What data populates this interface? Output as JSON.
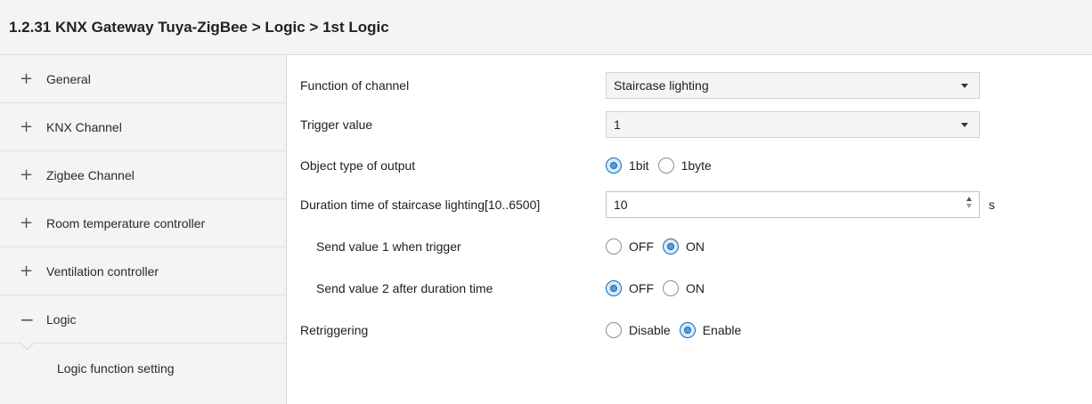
{
  "header": {
    "title": "1.2.31 KNX Gateway Tuya-ZigBee > Logic > 1st Logic"
  },
  "sidebar": {
    "items": [
      {
        "icon": "plus-icon",
        "symbol": "+",
        "label": "General"
      },
      {
        "icon": "plus-icon",
        "symbol": "+",
        "label": "KNX Channel"
      },
      {
        "icon": "plus-icon",
        "symbol": "+",
        "label": "Zigbee Channel"
      },
      {
        "icon": "plus-icon",
        "symbol": "+",
        "label": "Room temperature controller"
      },
      {
        "icon": "plus-icon",
        "symbol": "+",
        "label": "Ventilation controller"
      },
      {
        "icon": "minus-icon",
        "symbol": "−",
        "label": "Logic"
      }
    ],
    "sub_item": {
      "label": "Logic function setting"
    }
  },
  "params": {
    "function_of_channel": {
      "label": "Function of channel",
      "value": "Staircase lighting"
    },
    "trigger_value": {
      "label": "Trigger value",
      "value": "1"
    },
    "object_type": {
      "label": "Object type of output",
      "options": [
        "1bit",
        "1byte"
      ],
      "selected": "1bit"
    },
    "duration": {
      "label": "Duration time of staircase lighting[10..6500]",
      "value": "10",
      "unit": "s"
    },
    "send_value_1": {
      "label": "Send value 1 when trigger",
      "options": [
        "OFF",
        "ON"
      ],
      "selected": "ON"
    },
    "send_value_2": {
      "label": "Send value 2 after duration time",
      "options": [
        "OFF",
        "ON"
      ],
      "selected": "OFF"
    },
    "retriggering": {
      "label": "Retriggering",
      "options": [
        "Disable",
        "Enable"
      ],
      "selected": "Enable"
    }
  },
  "colors": {
    "accent": "#0f6cbd",
    "sidebar_bg": "#f3f4f4",
    "header_bg": "#f3f5f5"
  }
}
